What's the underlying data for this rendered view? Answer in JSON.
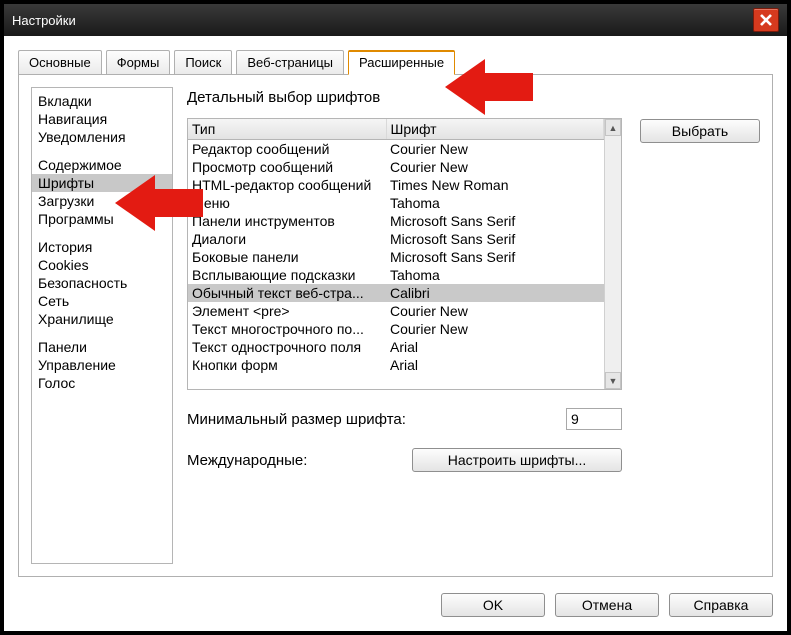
{
  "window": {
    "title": "Настройки"
  },
  "tabs": [
    {
      "label": "Основные"
    },
    {
      "label": "Формы"
    },
    {
      "label": "Поиск"
    },
    {
      "label": "Веб-страницы"
    },
    {
      "label": "Расширенные",
      "active": true
    }
  ],
  "sidebar": {
    "groups": [
      {
        "items": [
          {
            "label": "Вкладки"
          },
          {
            "label": "Навигация"
          },
          {
            "label": "Уведомления"
          }
        ]
      },
      {
        "items": [
          {
            "label": "Содержимое"
          },
          {
            "label": "Шрифты",
            "selected": true
          },
          {
            "label": "Загрузки"
          },
          {
            "label": "Программы"
          }
        ]
      },
      {
        "items": [
          {
            "label": "История"
          },
          {
            "label": "Cookies"
          },
          {
            "label": "Безопасность"
          },
          {
            "label": "Сеть"
          },
          {
            "label": "Хранилище"
          }
        ]
      },
      {
        "items": [
          {
            "label": "Панели"
          },
          {
            "label": "Управление"
          },
          {
            "label": "Голос"
          }
        ]
      }
    ]
  },
  "main": {
    "heading": "Детальный выбор шрифтов",
    "table": {
      "headers": {
        "type": "Тип",
        "font": "Шрифт"
      },
      "rows": [
        {
          "type": "Редактор сообщений",
          "font": "Courier New"
        },
        {
          "type": "Просмотр сообщений",
          "font": "Courier New"
        },
        {
          "type": "HTML-редактор сообщений",
          "font": "Times New Roman"
        },
        {
          "type": "Меню",
          "font": "Tahoma"
        },
        {
          "type": "Панели инструментов",
          "font": "Microsoft Sans Serif"
        },
        {
          "type": "Диалоги",
          "font": "Microsoft Sans Serif"
        },
        {
          "type": "Боковые панели",
          "font": "Microsoft Sans Serif"
        },
        {
          "type": "Всплывающие подсказки",
          "font": "Tahoma"
        },
        {
          "type": "Обычный текст веб-стра...",
          "font": "Calibri",
          "selected": true
        },
        {
          "type": "Элемент <pre>",
          "font": "Courier New"
        },
        {
          "type": "Текст многострочного по...",
          "font": "Courier New"
        },
        {
          "type": "Текст однострочного поля",
          "font": "Arial"
        },
        {
          "type": "Кнопки форм",
          "font": "Arial"
        }
      ]
    },
    "select_button": "Выбрать",
    "min_size_label": "Минимальный размер шрифта:",
    "min_size_value": "9",
    "intl_label": "Международные:",
    "intl_button": "Настроить шрифты..."
  },
  "footer": {
    "ok": "OK",
    "cancel": "Отмена",
    "help": "Справка"
  },
  "arrow_color": "#e31b12"
}
